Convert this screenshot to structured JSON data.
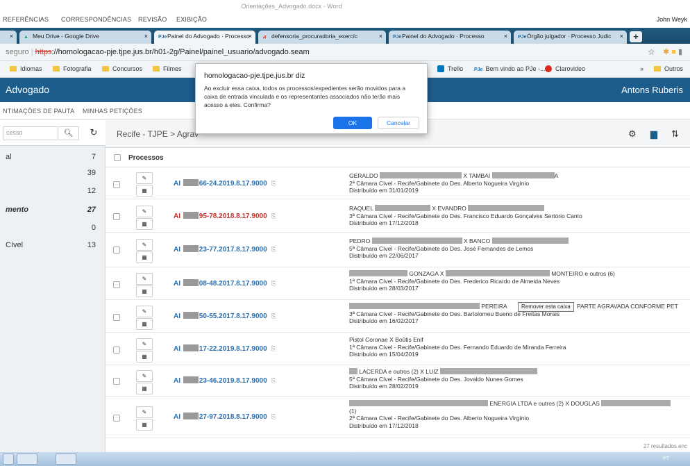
{
  "word": {
    "doc_title": "Orientações_Advogado.docx - Word",
    "menus": [
      "REFERÊNCIAS",
      "CORRESPONDÊNCIAS",
      "REVISÃO",
      "EXIBIÇÃO"
    ],
    "user": "John Weyk"
  },
  "browser": {
    "tabs": [
      {
        "label": "Meu Drive - Google Drive",
        "icon": "google-drive-icon"
      },
      {
        "label": "Painel do Advogado · Processo",
        "icon": "pje-icon",
        "active": true
      },
      {
        "label": "defensoria_procuradoria_exercíc",
        "icon": "pdf-icon"
      },
      {
        "label": "Painel do Advogado · Processo",
        "icon": "pje-icon"
      },
      {
        "label": "Órgão julgador · Processo Judic",
        "icon": "pje-icon"
      }
    ],
    "url_insecure": "seguro",
    "url_scheme": "https",
    "url_rest": "://homologacao-pje.tjpe.jus.br/h01-2g/Painel/painel_usuario/advogado.seam",
    "bookmarks": [
      "Idiomas",
      "Fotografia",
      "Concursos",
      "Filmes"
    ],
    "bookmarks_right": {
      "trello": "Trello",
      "pje": "Bem vindo ao PJe -...",
      "claro": "Clarovideo",
      "more": "»",
      "outros": "Outros"
    }
  },
  "app": {
    "brand": "Advogado",
    "user": "Antons Ruberis",
    "subnav": [
      "NTIMAÇÕES DE PAUTA",
      "MINHAS PETIÇÕES"
    ]
  },
  "sidebar": {
    "search_placeholder": "cesso",
    "items": [
      {
        "label": "al",
        "count": "7",
        "bold": false
      },
      {
        "label": "",
        "count": "39",
        "bold": false
      },
      {
        "label": "",
        "count": "12",
        "bold": false
      },
      {
        "label": "mento",
        "count": "27",
        "bold": true
      },
      {
        "label": "",
        "count": "0",
        "bold": false
      },
      {
        "label": "Cível",
        "count": "13",
        "bold": false
      }
    ]
  },
  "main": {
    "breadcrumb": "Recife - TJPE > Agrav",
    "column": "Processos",
    "tooltip": "Remover esta caixa",
    "footer": "27 resultados enc",
    "rows": [
      {
        "prefix": "AI",
        "num": "66-24.2019.8.17.9000",
        "red": false,
        "line1a": "GERALDO",
        "line1b": "X TAMBAI",
        "line1c": "A",
        "line2": "2ª Câmara Cível - Recife/Gabinete do Des. Alberto Nogueira Virgínio",
        "line3": "Distribuído em 31/01/2019"
      },
      {
        "prefix": "AI",
        "num": "95-78.2018.8.17.9000",
        "red": true,
        "line1a": "RAQUEL",
        "line1b": "X EVANDRO",
        "line1c": "",
        "line2": "3ª Câmara Cível - Recife/Gabinete do Des. Francisco Eduardo Gonçalves Sertório Canto",
        "line3": "Distribuído em 17/12/2018"
      },
      {
        "prefix": "AI",
        "num": "23-77.2017.8.17.9000",
        "red": false,
        "line1a": "PEDRO",
        "line1b": "X BANCO",
        "line1c": "",
        "line2": "5ª Câmara Cível - Recife/Gabinete do Des. José Fernandes de Lemos",
        "line3": "Distribuído em 22/06/2017"
      },
      {
        "prefix": "AI",
        "num": "08-48.2017.8.17.9000",
        "red": false,
        "line1a": "",
        "line1b": "GONZAGA X",
        "line1c": "MONTEIRO e outros (6)",
        "line2": "1ª Câmara Cível - Recife/Gabinete do Des. Frederico Ricardo de Almeida Neves",
        "line3": "Distribuído em 28/03/2017"
      },
      {
        "prefix": "AI",
        "num": "50-55.2017.8.17.9000",
        "red": false,
        "line1a": "",
        "line1b": "PEREIRA",
        "line1c": "PARTE AGRAVADA CONFORME PET",
        "line2": "3ª Câmara Cível - Recife/Gabinete do Des. Bartolomeu Bueno de Freitas Morais",
        "line3": "Distribuído em 16/02/2017"
      },
      {
        "prefix": "AI",
        "num": "17-22.2019.8.17.9000",
        "red": false,
        "line1a": "Pistol Coronae X Boûtis Enif",
        "line1b": "",
        "line1c": "",
        "line2": "1ª Câmara Cível - Recife/Gabinete do Des. Fernando Eduardo de Miranda Ferreira",
        "line3": "Distribuído em 15/04/2019"
      },
      {
        "prefix": "AI",
        "num": "23-46.2019.8.17.9000",
        "red": false,
        "line1a": "LACERDA e outros (2) X LUIZ",
        "line1b": "",
        "line1c": "",
        "line2": "5ª Câmara Cível - Recife/Gabinete do Des. Jovaldo Nunes Gomes",
        "line3": "Distribuído em 28/02/2019"
      },
      {
        "prefix": "AI",
        "num": "27-97.2018.8.17.9000",
        "red": false,
        "line1a": "",
        "line1b": "ENERGIA LTDA e outros (2) X DOUGLAS",
        "line1c": "",
        "line2": "(1)",
        "line3": "2ª Câmara Cível - Recife/Gabinete do Des. Alberto Nogueira Virgínio",
        "line4": "Distribuído em 17/12/2018"
      }
    ]
  },
  "dialog": {
    "title": "homologacao-pje.tjpe.jus.br diz",
    "message": "Ao excluir essa caixa, todos os processos/expedientes serão movidos para a caixa de entrada vinculada e os representantes associados não terão mais acesso a eles. Confirma?",
    "ok": "OK",
    "cancel": "Cancelar"
  },
  "taskbar": {
    "lang": "PT"
  }
}
